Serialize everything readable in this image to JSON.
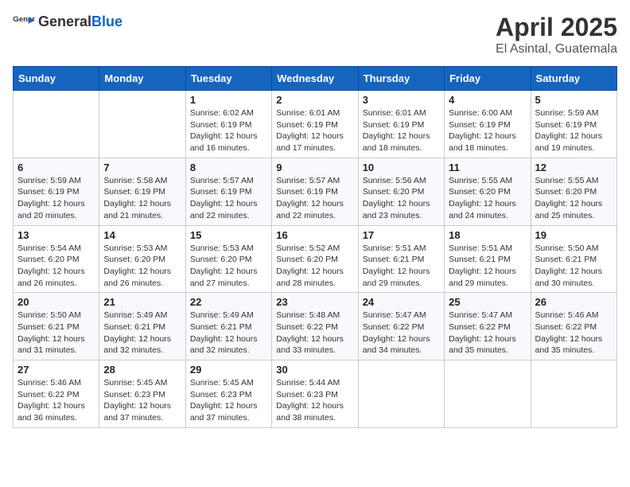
{
  "header": {
    "logo_general": "General",
    "logo_blue": "Blue",
    "month_title": "April 2025",
    "location": "El Asintal, Guatemala"
  },
  "days_of_week": [
    "Sunday",
    "Monday",
    "Tuesday",
    "Wednesday",
    "Thursday",
    "Friday",
    "Saturday"
  ],
  "weeks": [
    [
      {
        "day": "",
        "info": ""
      },
      {
        "day": "",
        "info": ""
      },
      {
        "day": "1",
        "info": "Sunrise: 6:02 AM\nSunset: 6:19 PM\nDaylight: 12 hours and 16 minutes."
      },
      {
        "day": "2",
        "info": "Sunrise: 6:01 AM\nSunset: 6:19 PM\nDaylight: 12 hours and 17 minutes."
      },
      {
        "day": "3",
        "info": "Sunrise: 6:01 AM\nSunset: 6:19 PM\nDaylight: 12 hours and 18 minutes."
      },
      {
        "day": "4",
        "info": "Sunrise: 6:00 AM\nSunset: 6:19 PM\nDaylight: 12 hours and 18 minutes."
      },
      {
        "day": "5",
        "info": "Sunrise: 5:59 AM\nSunset: 6:19 PM\nDaylight: 12 hours and 19 minutes."
      }
    ],
    [
      {
        "day": "6",
        "info": "Sunrise: 5:59 AM\nSunset: 6:19 PM\nDaylight: 12 hours and 20 minutes."
      },
      {
        "day": "7",
        "info": "Sunrise: 5:58 AM\nSunset: 6:19 PM\nDaylight: 12 hours and 21 minutes."
      },
      {
        "day": "8",
        "info": "Sunrise: 5:57 AM\nSunset: 6:19 PM\nDaylight: 12 hours and 22 minutes."
      },
      {
        "day": "9",
        "info": "Sunrise: 5:57 AM\nSunset: 6:19 PM\nDaylight: 12 hours and 22 minutes."
      },
      {
        "day": "10",
        "info": "Sunrise: 5:56 AM\nSunset: 6:20 PM\nDaylight: 12 hours and 23 minutes."
      },
      {
        "day": "11",
        "info": "Sunrise: 5:55 AM\nSunset: 6:20 PM\nDaylight: 12 hours and 24 minutes."
      },
      {
        "day": "12",
        "info": "Sunrise: 5:55 AM\nSunset: 6:20 PM\nDaylight: 12 hours and 25 minutes."
      }
    ],
    [
      {
        "day": "13",
        "info": "Sunrise: 5:54 AM\nSunset: 6:20 PM\nDaylight: 12 hours and 26 minutes."
      },
      {
        "day": "14",
        "info": "Sunrise: 5:53 AM\nSunset: 6:20 PM\nDaylight: 12 hours and 26 minutes."
      },
      {
        "day": "15",
        "info": "Sunrise: 5:53 AM\nSunset: 6:20 PM\nDaylight: 12 hours and 27 minutes."
      },
      {
        "day": "16",
        "info": "Sunrise: 5:52 AM\nSunset: 6:20 PM\nDaylight: 12 hours and 28 minutes."
      },
      {
        "day": "17",
        "info": "Sunrise: 5:51 AM\nSunset: 6:21 PM\nDaylight: 12 hours and 29 minutes."
      },
      {
        "day": "18",
        "info": "Sunrise: 5:51 AM\nSunset: 6:21 PM\nDaylight: 12 hours and 29 minutes."
      },
      {
        "day": "19",
        "info": "Sunrise: 5:50 AM\nSunset: 6:21 PM\nDaylight: 12 hours and 30 minutes."
      }
    ],
    [
      {
        "day": "20",
        "info": "Sunrise: 5:50 AM\nSunset: 6:21 PM\nDaylight: 12 hours and 31 minutes."
      },
      {
        "day": "21",
        "info": "Sunrise: 5:49 AM\nSunset: 6:21 PM\nDaylight: 12 hours and 32 minutes."
      },
      {
        "day": "22",
        "info": "Sunrise: 5:49 AM\nSunset: 6:21 PM\nDaylight: 12 hours and 32 minutes."
      },
      {
        "day": "23",
        "info": "Sunrise: 5:48 AM\nSunset: 6:22 PM\nDaylight: 12 hours and 33 minutes."
      },
      {
        "day": "24",
        "info": "Sunrise: 5:47 AM\nSunset: 6:22 PM\nDaylight: 12 hours and 34 minutes."
      },
      {
        "day": "25",
        "info": "Sunrise: 5:47 AM\nSunset: 6:22 PM\nDaylight: 12 hours and 35 minutes."
      },
      {
        "day": "26",
        "info": "Sunrise: 5:46 AM\nSunset: 6:22 PM\nDaylight: 12 hours and 35 minutes."
      }
    ],
    [
      {
        "day": "27",
        "info": "Sunrise: 5:46 AM\nSunset: 6:22 PM\nDaylight: 12 hours and 36 minutes."
      },
      {
        "day": "28",
        "info": "Sunrise: 5:45 AM\nSunset: 6:23 PM\nDaylight: 12 hours and 37 minutes."
      },
      {
        "day": "29",
        "info": "Sunrise: 5:45 AM\nSunset: 6:23 PM\nDaylight: 12 hours and 37 minutes."
      },
      {
        "day": "30",
        "info": "Sunrise: 5:44 AM\nSunset: 6:23 PM\nDaylight: 12 hours and 38 minutes."
      },
      {
        "day": "",
        "info": ""
      },
      {
        "day": "",
        "info": ""
      },
      {
        "day": "",
        "info": ""
      }
    ]
  ]
}
